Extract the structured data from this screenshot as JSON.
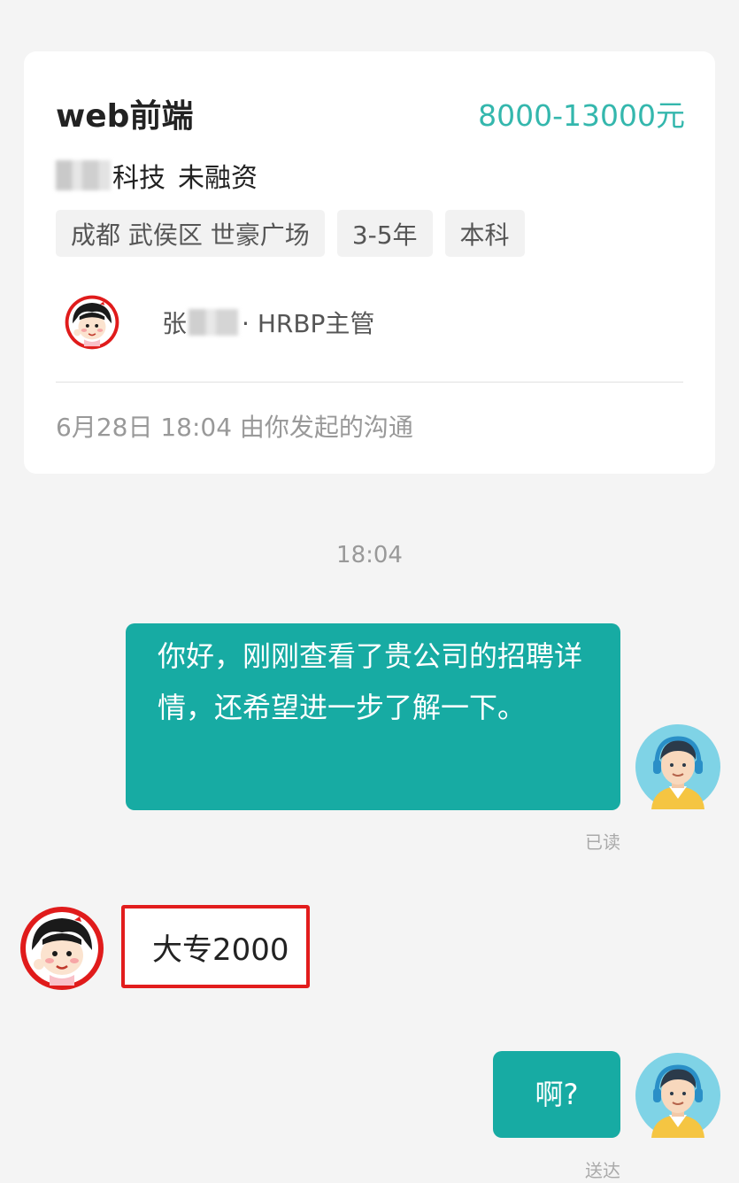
{
  "job": {
    "title": "web前端",
    "salary": "8000-13000元",
    "company_suffix": "科技",
    "funding": "未融资",
    "tags": [
      "成都 武侯区 世豪广场",
      "3-5年",
      "本科"
    ],
    "recruiter_surname": "张",
    "recruiter_role": "· HRBP主管",
    "started_note": "6月28日 18:04 由你发起的沟通"
  },
  "chat": {
    "timestamp": "18:04",
    "messages": [
      {
        "side": "right",
        "text": "你好，刚刚查看了贵公司的招聘详情，还希望进一步了解一下。",
        "status": "已读"
      },
      {
        "side": "left",
        "text": "大专2000"
      },
      {
        "side": "right",
        "text": "啊?",
        "status": "送达"
      }
    ]
  },
  "colors": {
    "accent": "#17aba3",
    "salary": "#34b7ad",
    "highlight_border": "#e21d1d",
    "background": "#f4f4f4"
  },
  "icons": {
    "recruiter_avatar": "cartoon-girl-avatar",
    "my_avatar": "headphones-man-avatar"
  }
}
